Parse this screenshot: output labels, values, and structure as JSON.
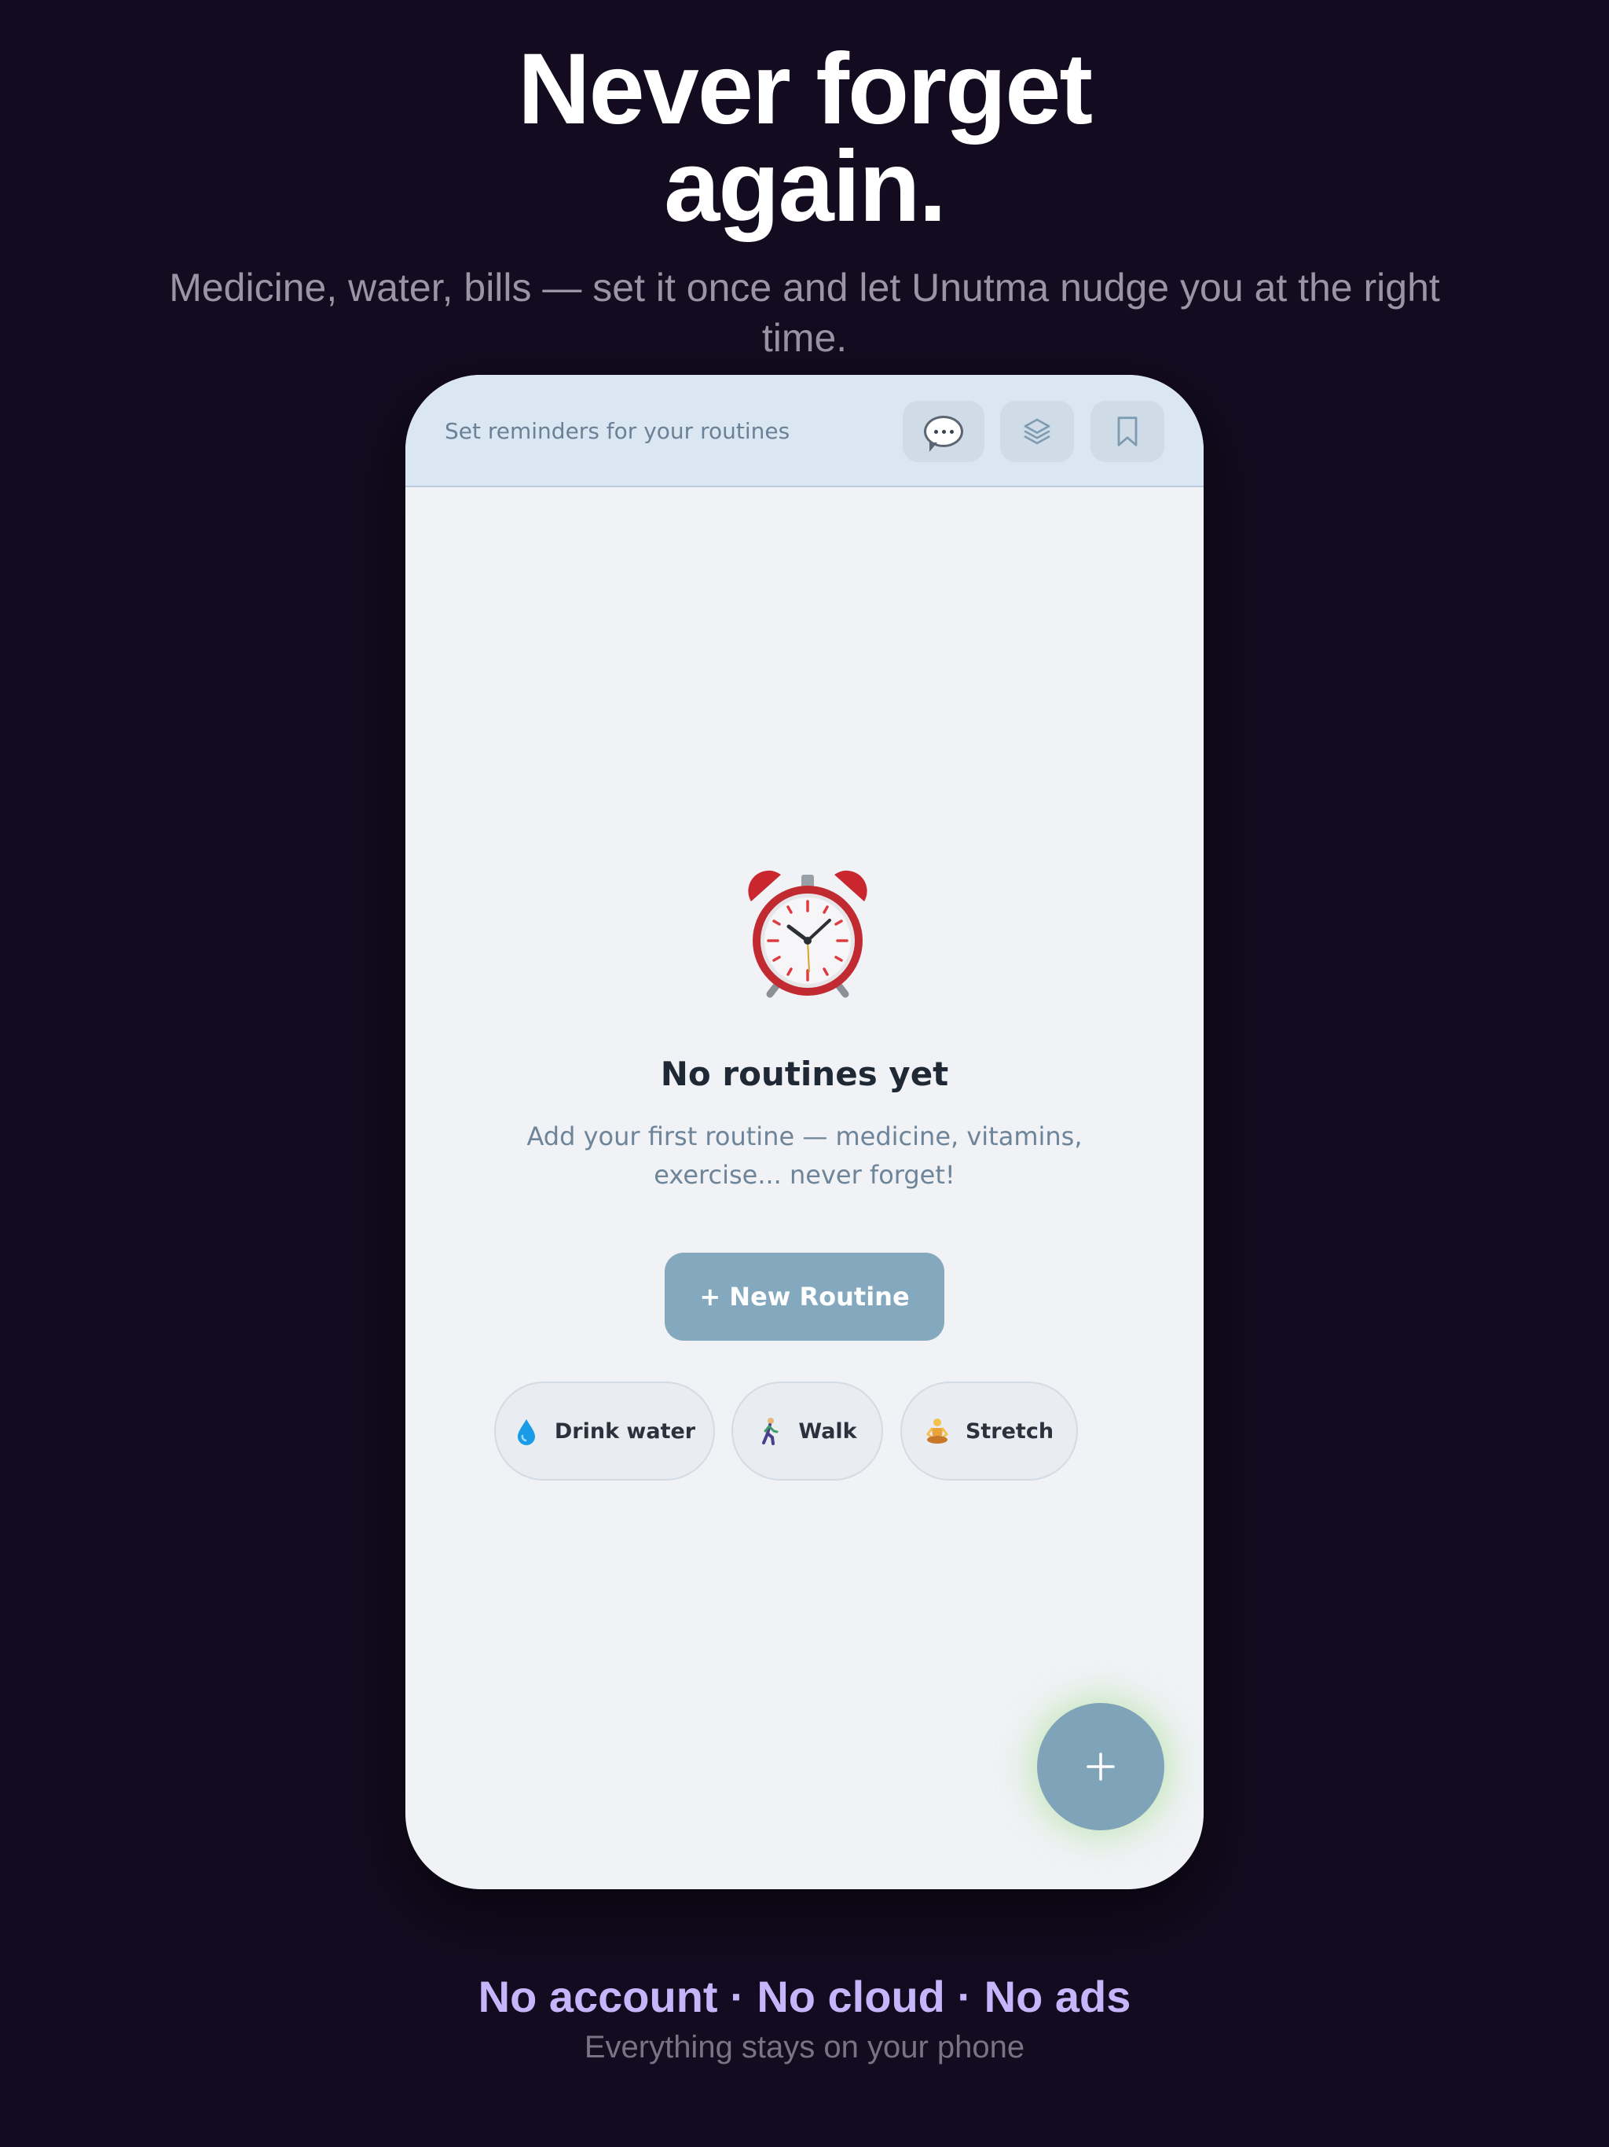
{
  "hero": {
    "title_line1": "Never forget",
    "title_line2": "again.",
    "subtitle": "Medicine, water, bills — set it once and let Unutma nudge you at the right time."
  },
  "app": {
    "header": {
      "caption": "Set reminders for your routines",
      "buttons": [
        {
          "icon": "speech-bubble-icon"
        },
        {
          "icon": "layers-icon"
        },
        {
          "icon": "bookmark-icon"
        }
      ]
    },
    "empty_state": {
      "icon": "alarm-clock-icon",
      "title": "No routines yet",
      "description": "Add your first routine — medicine, vitamins, exercise... never forget!",
      "cta_label": "+ New Routine"
    },
    "suggestions": [
      {
        "icon": "droplet-icon",
        "label": "Drink water"
      },
      {
        "icon": "walking-person-icon",
        "label": "Walk"
      },
      {
        "icon": "meditating-person-icon",
        "label": "Stretch"
      }
    ],
    "fab": {
      "icon": "plus-icon"
    }
  },
  "footer": {
    "tagline": "No account · No cloud · No ads",
    "subtext": "Everything stays on your phone"
  },
  "colors": {
    "background": "#130b1f",
    "accent": "#84a8be",
    "tagline": "#c6b5fb",
    "header_bg": "#dae6f1"
  }
}
